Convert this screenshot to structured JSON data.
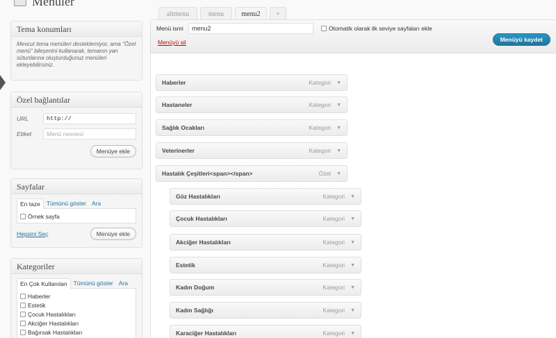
{
  "page": {
    "title": "Menüler"
  },
  "tema": {
    "title": "Tema konumları",
    "help": "Mevcut tema menüleri desteklemiyor, ama \"Özel menü\" bileşenini kullanarak, temanın yan sütunlarına oluşturduğunuz menüleri ekleyebilirsiniz."
  },
  "custom_links": {
    "title": "Özel bağlantılar",
    "url_label": "URL",
    "url_value": "http://",
    "label_label": "Etiket",
    "label_placeholder": "Menü nesnesi",
    "add_button": "Menüye ekle"
  },
  "pages_box": {
    "title": "Sayfalar",
    "tabs": [
      "En taze",
      "Tümünü göster",
      "Ara"
    ],
    "items": [
      "Örnek sayfa"
    ],
    "select_all": "Hepsini Seç",
    "add_button": "Menüye ekle"
  },
  "categories_box": {
    "title": "Kategoriler",
    "tabs": [
      "En Çok Kullanılan",
      "Tümünü göster",
      "Ara"
    ],
    "items": [
      "Haberler",
      "Estetik",
      "Çocuk Hastalıkları",
      "Akciğer Hastalıkları",
      "Bağırsak Hastalıkları"
    ]
  },
  "menu_tabs": [
    "altmenu",
    "menu",
    "menu2",
    "+"
  ],
  "menu_editor": {
    "name_label": "Menü ismi",
    "name_value": "menu2",
    "auto_add_label": "Otomatik olarak ilk seviye sayfaları ekle",
    "save_button": "Menüyü kaydet",
    "delete_link": "Menüyü sil"
  },
  "menu_items": [
    {
      "title": "Haberler",
      "type": "Kategori"
    },
    {
      "title": "Hastaneler",
      "type": "Kategori"
    },
    {
      "title": "Sağlık Ocakları",
      "type": "Kategori"
    },
    {
      "title": "Veterinerler",
      "type": "Kategori"
    },
    {
      "title": "Hastalık Çeşitleri<span></span>",
      "type": "Özel"
    },
    {
      "title": "Göz Hastalıkları",
      "type": "Kategori"
    },
    {
      "title": "Çocuk Hastalıkları",
      "type": "Kategori"
    },
    {
      "title": "Akciğer Hastalıkları",
      "type": "Kategori"
    },
    {
      "title": "Estetik",
      "type": "Kategori"
    },
    {
      "title": "Kadın Doğum",
      "type": "Kategori"
    },
    {
      "title": "Kadın Sağlığı",
      "type": "Kategori"
    },
    {
      "title": "Karaciğer Hastalıkları",
      "type": "Kategori"
    }
  ],
  "colors": {
    "accent": "#21759b",
    "danger": "#bc0b0b",
    "border": "#dfdfdf"
  },
  "icons": {
    "dropdown": "triangle-down-icon",
    "page": "menus-page-icon"
  }
}
